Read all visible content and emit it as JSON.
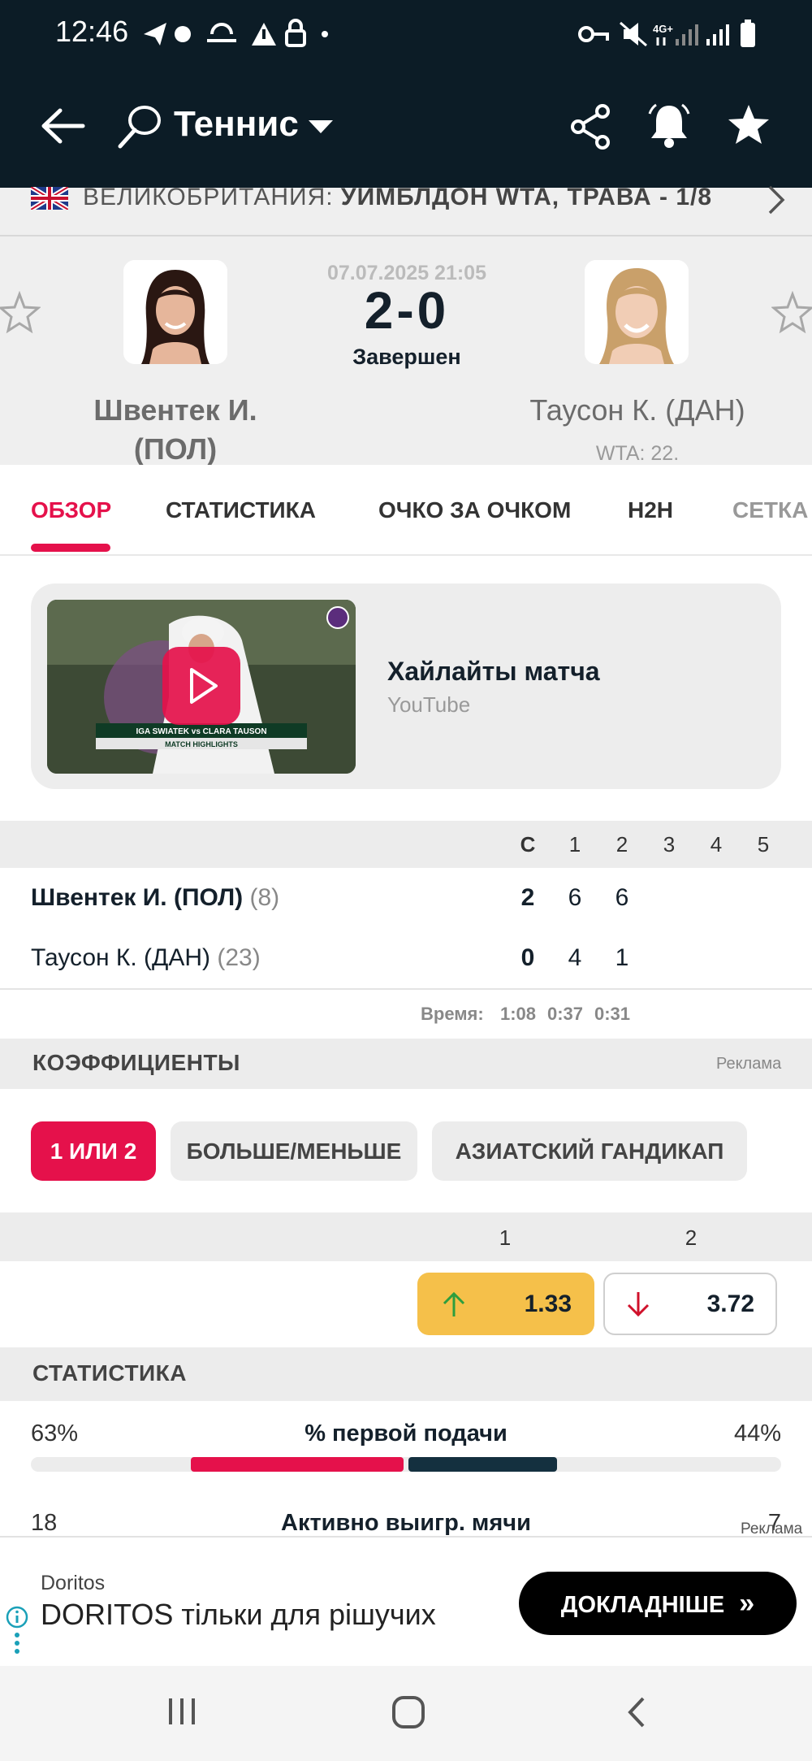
{
  "status_bar": {
    "time": "12:46",
    "network": "4G+"
  },
  "app_bar": {
    "sport": "Теннис"
  },
  "tournament": {
    "country": "ВЕЛИКОБРИТАНИЯ:",
    "name": "УИМБЛДОН WTA, ТРАВА - 1/8"
  },
  "match": {
    "datetime": "07.07.2025 21:05",
    "score": "2-0",
    "status": "Завершен",
    "home": {
      "name_line1": "Швентек И.",
      "name_line2": "(ПОЛ)"
    },
    "away": {
      "name": "Таусон К. (ДАН)",
      "rank": "WTA: 22."
    }
  },
  "tabs": [
    "ОБЗОР",
    "СТАТИСТИКА",
    "ОЧКО ЗА ОЧКОМ",
    "H2H",
    "СЕТКА"
  ],
  "video": {
    "title": "Хайлайты матча",
    "source": "YouTube",
    "thumb_caption_names": "IGA SWIATEK vs CLARA TAUSON",
    "thumb_caption_sub": "MATCH HIGHLIGHTS"
  },
  "scoreboard": {
    "headers": [
      "С",
      "1",
      "2",
      "3",
      "4",
      "5"
    ],
    "rows": [
      {
        "name": "Швентек И. (ПОЛ)",
        "seed": "(8)",
        "sets": "2",
        "s1": "6",
        "s2": "6"
      },
      {
        "name": "Таусон К. (ДАН)",
        "seed": "(23)",
        "sets": "0",
        "s1": "4",
        "s2": "1"
      }
    ],
    "time_label": "Время:",
    "times": [
      "1:08",
      "0:37",
      "0:31"
    ]
  },
  "odds": {
    "section_title": "КОЭФФИЦИЕНТЫ",
    "ad_label": "Реклама",
    "market_tabs": [
      "1 ИЛИ 2",
      "БОЛЬШЕ/МЕНЬШЕ",
      "АЗИАТСКИЙ ГАНДИКАП"
    ],
    "col1": "1",
    "col2": "2",
    "home_odd": "1.33",
    "away_odd": "3.72"
  },
  "stats": {
    "section_title": "СТАТИСТИКА",
    "first_serve": {
      "label": "% первой подачи",
      "home": "63%",
      "away": "44%",
      "home_pct": 63,
      "away_pct": 44
    },
    "partial": {
      "label": "Активно выигр. мячи",
      "home": "18",
      "away": "7"
    }
  },
  "ad": {
    "label": "Реклама",
    "brand": "Doritos",
    "text": "DORITOS тільки для рішучих",
    "button": "ДОКЛАДНІШЕ"
  },
  "colors": {
    "accent": "#e5114b",
    "dark": "#0c1c26",
    "odds_up": "#f5c04a"
  }
}
